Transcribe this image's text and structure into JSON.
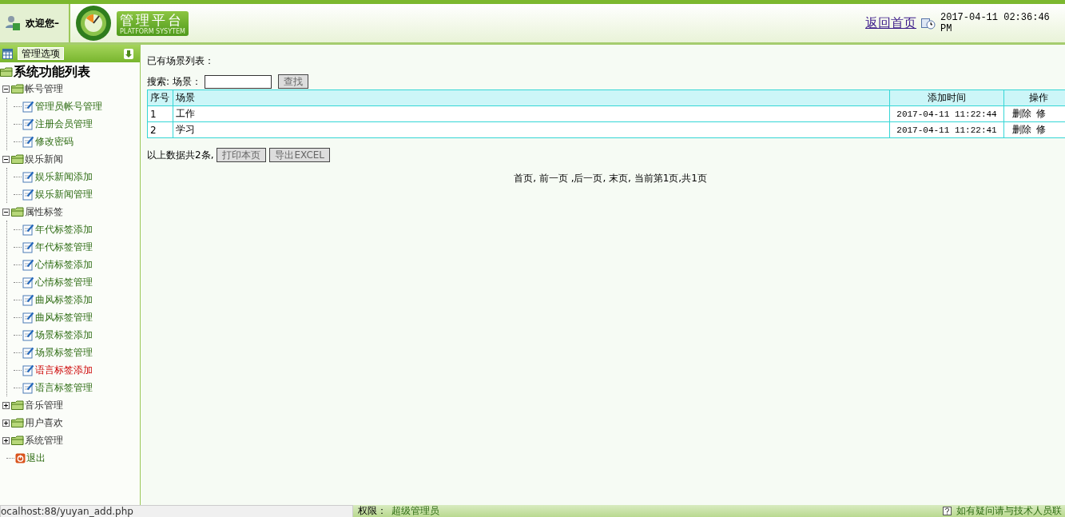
{
  "header": {
    "welcome": "欢迎您–",
    "logo_title": "管理平台",
    "logo_subtitle": "PLATFORM SYSYTEM",
    "home_link": "返回首页",
    "datetime": "2017-04-11 02:36:46 PM"
  },
  "sidebar": {
    "options_button": "管理选项",
    "tree": {
      "label": "系统功能列表",
      "children": [
        {
          "kind": "folder",
          "label": "帐号管理",
          "expanded": true,
          "children": [
            {
              "kind": "page",
              "label": "管理员帐号管理",
              "selected": false
            },
            {
              "kind": "page",
              "label": "注册会员管理",
              "selected": false
            },
            {
              "kind": "page",
              "label": "修改密码",
              "selected": false
            }
          ]
        },
        {
          "kind": "folder",
          "label": "娱乐新闻",
          "expanded": true,
          "children": [
            {
              "kind": "page",
              "label": "娱乐新闻添加",
              "selected": false
            },
            {
              "kind": "page",
              "label": "娱乐新闻管理",
              "selected": false
            }
          ]
        },
        {
          "kind": "folder",
          "label": "属性标签",
          "expanded": true,
          "children": [
            {
              "kind": "page",
              "label": "年代标签添加",
              "selected": false
            },
            {
              "kind": "page",
              "label": "年代标签管理",
              "selected": false
            },
            {
              "kind": "page",
              "label": "心情标签添加",
              "selected": false
            },
            {
              "kind": "page",
              "label": "心情标签管理",
              "selected": false
            },
            {
              "kind": "page",
              "label": "曲风标签添加",
              "selected": false
            },
            {
              "kind": "page",
              "label": "曲风标签管理",
              "selected": false
            },
            {
              "kind": "page",
              "label": "场景标签添加",
              "selected": false
            },
            {
              "kind": "page",
              "label": "场景标签管理",
              "selected": false
            },
            {
              "kind": "page",
              "label": "语言标签添加",
              "selected": true
            },
            {
              "kind": "page",
              "label": "语言标签管理",
              "selected": false
            }
          ]
        },
        {
          "kind": "folder",
          "label": "音乐管理",
          "expanded": false
        },
        {
          "kind": "folder",
          "label": "用户喜欢",
          "expanded": false
        },
        {
          "kind": "folder",
          "label": "系统管理",
          "expanded": false
        },
        {
          "kind": "exit",
          "label": "退出"
        }
      ]
    }
  },
  "main": {
    "heading": "已有场景列表：",
    "search_label": "搜索:",
    "field_label": "场景：",
    "search_button": "查找",
    "table": {
      "columns": [
        "序号",
        "场景",
        "添加时间",
        "操作"
      ],
      "rows": [
        {
          "cells": [
            "1",
            "工作",
            "2017-04-11 11:22:44"
          ],
          "actions": [
            "删除",
            "修"
          ]
        },
        {
          "cells": [
            "2",
            "学习",
            "2017-04-11 11:22:41"
          ],
          "actions": [
            "删除",
            "修"
          ]
        }
      ]
    },
    "summary": "以上数据共2条,",
    "buttons": [
      "打印本页",
      "导出EXCEL"
    ],
    "pagination": "首页, 前一页 ,后一页, 末页, 当前第1页,共1页"
  },
  "footer": {
    "status_url": "ocalhost:88/yuyan_add.php",
    "permission_label": "权限：",
    "permission_value": "超级管理员",
    "help_text": "如有疑问请与技术人员联"
  }
}
